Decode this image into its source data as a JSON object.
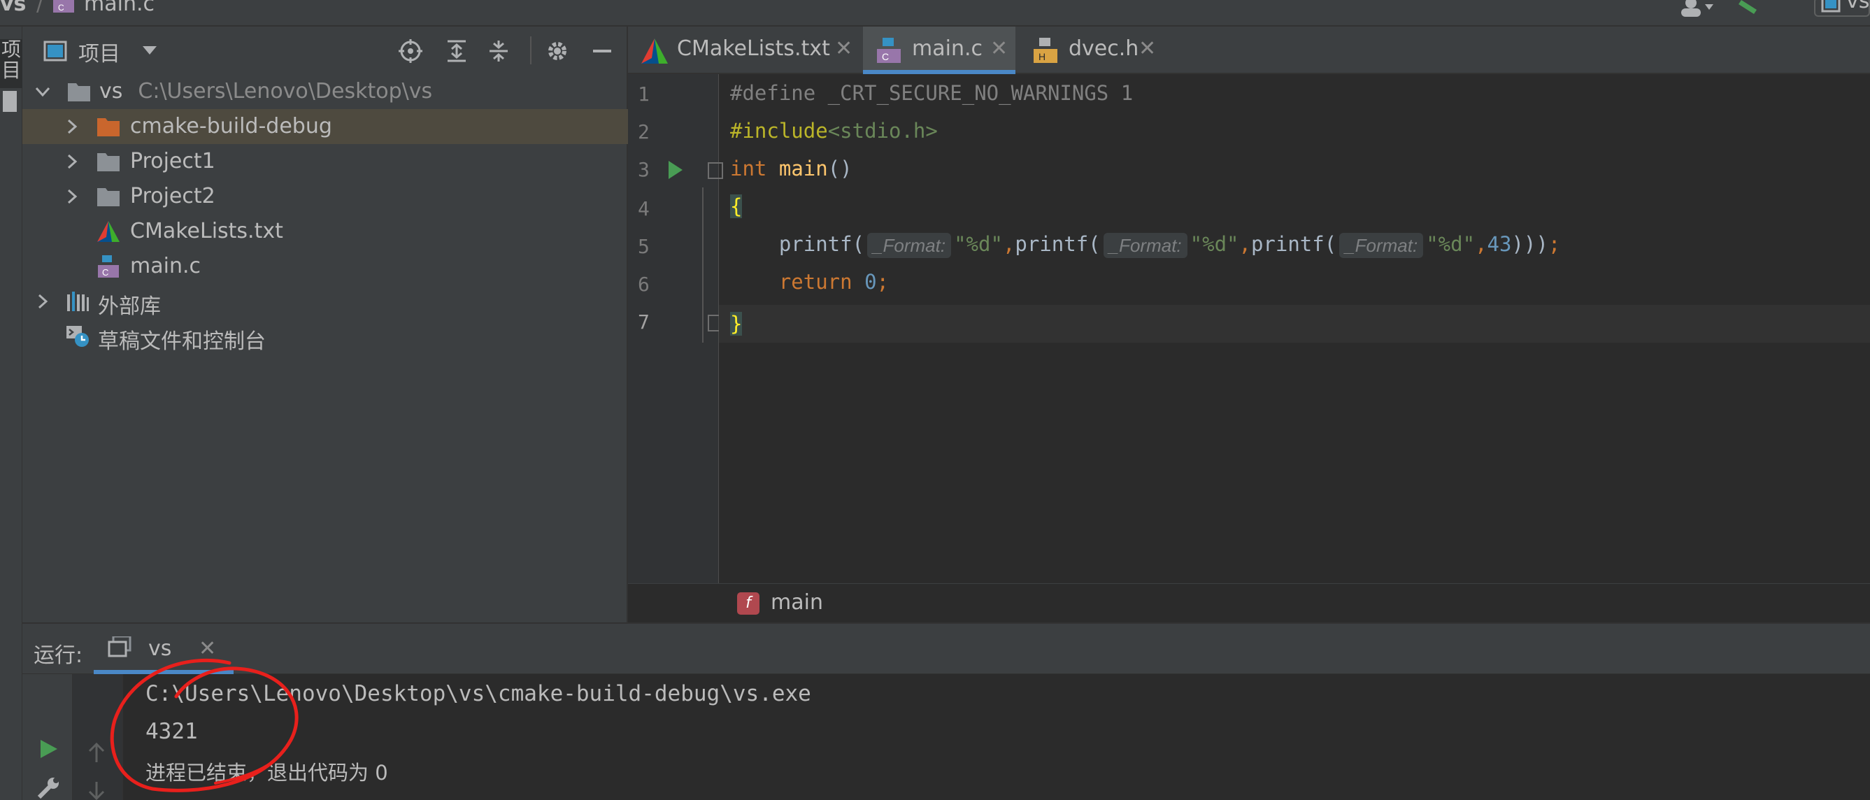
{
  "topbar": {
    "root": "vs",
    "separator": "/",
    "file": "main.c",
    "right_text": "vs"
  },
  "leftstrip": {
    "label": "项目"
  },
  "project": {
    "title": "项目",
    "tree": [
      {
        "name": "vs",
        "path": "C:\\Users\\Lenovo\\Desktop\\vs",
        "icon": "folder-icon"
      },
      {
        "name": "cmake-build-debug",
        "icon": "folder-orange-icon",
        "selected": true
      },
      {
        "name": "Project1",
        "icon": "folder-icon"
      },
      {
        "name": "Project2",
        "icon": "folder-icon"
      },
      {
        "name": "CMakeLists.txt",
        "icon": "cmake-icon"
      },
      {
        "name": "main.c",
        "icon": "c-file-icon"
      },
      {
        "name": "外部库",
        "icon": "library-icon"
      },
      {
        "name": "草稿文件和控制台",
        "icon": "scratches-icon"
      }
    ]
  },
  "tabs": [
    {
      "label": "CMakeLists.txt",
      "icon": "cmake-icon",
      "close": "✕"
    },
    {
      "label": "main.c",
      "icon": "c-file-icon",
      "close": "✕",
      "active": true
    },
    {
      "label": "dvec.h",
      "icon": "h-file-icon",
      "close": "✕"
    }
  ],
  "editor": {
    "line_numbers": [
      "1",
      "2",
      "3",
      "4",
      "5",
      "6",
      "7"
    ],
    "line1": {
      "directive": "#define",
      "rest": " _CRT_SECURE_NO_WARNINGS 1"
    },
    "line2": {
      "directive": "#include",
      "header": "<stdio.h>"
    },
    "line3": {
      "type": "int",
      "name": "main",
      "parens": "()"
    },
    "line4": {
      "brace": "{"
    },
    "line5": {
      "indent": "    ",
      "call": "printf(",
      "hint": "_Format:",
      "fmt": "\"%d\"",
      "comma": ",",
      "num": "43",
      "close": ")))",
      "semi": ";"
    },
    "line6": {
      "indent": "    ",
      "kw": "return",
      "num": "0",
      "semi": ";"
    },
    "line7": {
      "brace": "}"
    }
  },
  "breadcrumb": {
    "badge": "f",
    "label": "main"
  },
  "run": {
    "label": "运行:",
    "tab": "vs",
    "tab_close": "✕",
    "output": [
      "C:\\Users\\Lenovo\\Desktop\\vs\\cmake-build-debug\\vs.exe",
      "4321",
      "进程已结束，退出代码为 0"
    ]
  },
  "colors": {
    "accent": "#4a88c7",
    "run_green": "#499c54",
    "annotation_red": "#e8201c",
    "selection": "#4e4a3f"
  }
}
